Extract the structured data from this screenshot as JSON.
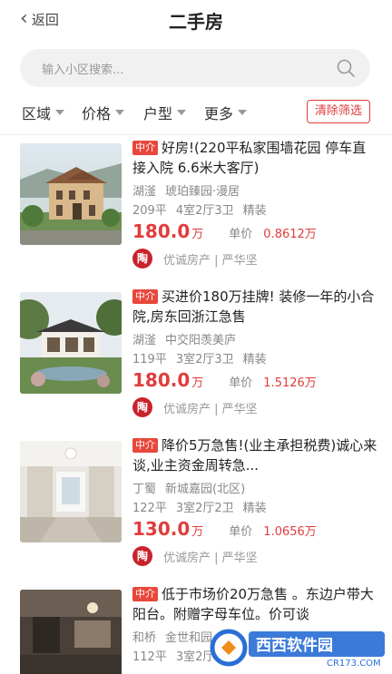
{
  "header": {
    "back_label": "返回",
    "title": "二手房"
  },
  "search": {
    "placeholder": "输入小区搜索..."
  },
  "filters": {
    "items": [
      "区域",
      "价格",
      "户型",
      "更多"
    ],
    "clear_label": "清除筛选"
  },
  "listings": [
    {
      "tag": "中介",
      "headline": "好房!(220平私家围墙花园 停车直接入院 6.6米大客厅)",
      "district": "湖滏",
      "community": "琥珀臻园·漫居",
      "area": "209平",
      "layout": "4室2厅3卫",
      "decoration": "精装",
      "price": "180.0",
      "price_unit": "万",
      "unit_price_label": "单价",
      "unit_price": "0.8612万",
      "agency_logo": "陶",
      "agency": "优诚房产 | 严华坚"
    },
    {
      "tag": "中介",
      "headline": "买进价180万挂牌! 装修一年的小合院,房东回浙江急售",
      "district": "湖滏",
      "community": "中交阳羡美庐",
      "area": "119平",
      "layout": "3室2厅3卫",
      "decoration": "精装",
      "price": "180.0",
      "price_unit": "万",
      "unit_price_label": "单价",
      "unit_price": "1.5126万",
      "agency_logo": "陶",
      "agency": "优诚房产 | 严华坚"
    },
    {
      "tag": "中介",
      "headline": "降价5万急售!(业主承担税费)诚心来谈,业主资金周转急...",
      "district": "丁蜀",
      "community": "新城嘉园(北区)",
      "area": "122平",
      "layout": "3室2厅2卫",
      "decoration": "精装",
      "price": "130.0",
      "price_unit": "万",
      "unit_price_label": "单价",
      "unit_price": "1.0656万",
      "agency_logo": "陶",
      "agency": "优诚房产 | 严华坚"
    },
    {
      "tag": "中介",
      "headline": "低于市场价20万急售 。东边户带大阳台。附赠字母车位。价可谈",
      "district": "和桥",
      "community": "金世和园",
      "area": "112平",
      "layout": "3室2厅",
      "decoration": "",
      "price": "",
      "price_unit": "",
      "unit_price_label": "",
      "unit_price": "",
      "agency_logo": "",
      "agency": ""
    }
  ],
  "watermark": {
    "brand": "西西软件园",
    "domain": "CR173.COM"
  },
  "colors": {
    "accent": "#e23c3c",
    "tag_bg": "#e8473c",
    "agency_logo_bg": "#c8232c",
    "watermark_blue": "#2a6fd6"
  }
}
